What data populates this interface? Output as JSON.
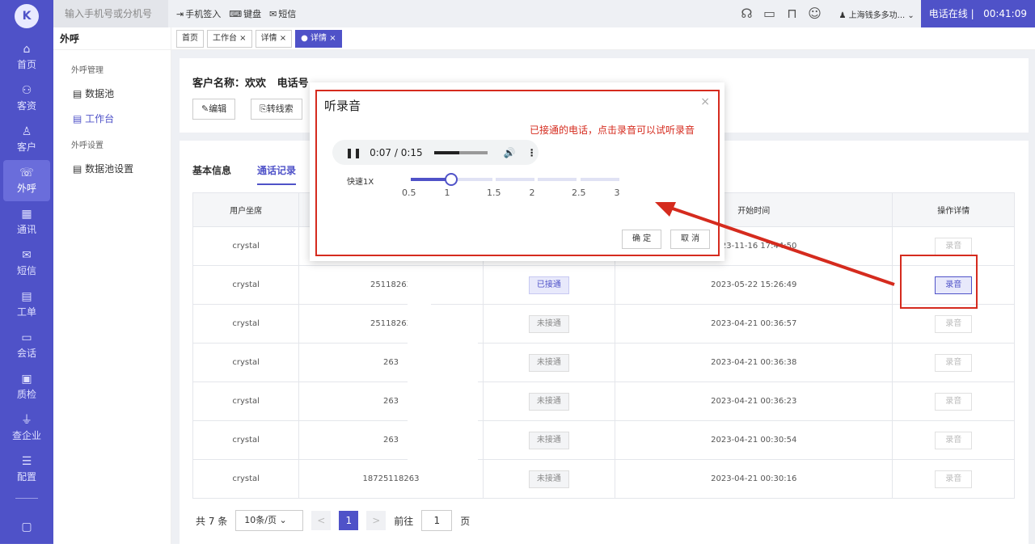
{
  "sidebar": {
    "logo": "K",
    "items": [
      {
        "icon": "⌂",
        "label": "首页"
      },
      {
        "icon": "⚇",
        "label": "客资"
      },
      {
        "icon": "♙",
        "label": "客户"
      },
      {
        "icon": "☏",
        "label": "外呼",
        "active": true
      },
      {
        "icon": "▦",
        "label": "通讯"
      },
      {
        "icon": "✉",
        "label": "短信"
      },
      {
        "icon": "▤",
        "label": "工单"
      },
      {
        "icon": "▭",
        "label": "会话"
      },
      {
        "icon": "▣",
        "label": "质检"
      },
      {
        "icon": "⏚",
        "label": "查企业"
      },
      {
        "icon": "☰",
        "label": "配置"
      },
      {
        "icon": "▢",
        "label": ""
      }
    ]
  },
  "topbar": {
    "search_placeholder": "输入手机号或分机号",
    "tool_signin": "手机签入",
    "tool_keyboard": "键盘",
    "tool_sms": "短信",
    "company": "上海钱多多功...",
    "status": "电话在线",
    "timer": "00:41:09"
  },
  "subnav": {
    "title": "外呼",
    "group1": "外呼管理",
    "link_datapool": "数据池",
    "link_workbench": "工作台",
    "group2": "外呼设置",
    "link_poolsetting": "数据池设置"
  },
  "tabs": [
    "首页",
    "工作台 ×",
    "详情 ×",
    "● 详情 ×"
  ],
  "customer": {
    "label": "客户名称：欢欢",
    "phone_label": "电话号"
  },
  "actions": {
    "edit": "编辑",
    "convert": "转线索"
  },
  "subtabs": {
    "basic": "基本信息",
    "records": "通话记录"
  },
  "table": {
    "headers": [
      "用户坐席",
      "",
      "",
      "开始时间",
      "操作详情"
    ],
    "rows": [
      {
        "agent": "crystal",
        "phone": "",
        "status": "",
        "start": "2023-11-16 17:44:50",
        "action": "录音",
        "active": false
      },
      {
        "agent": "crystal",
        "phone": "25118263",
        "status": "已接通",
        "start": "2023-05-22 15:26:49",
        "action": "录音",
        "active": true
      },
      {
        "agent": "crystal",
        "phone": "25118263",
        "status": "未接通",
        "start": "2023-04-21 00:36:57",
        "action": "录音",
        "active": false
      },
      {
        "agent": "crystal",
        "phone": "263",
        "status": "未接通",
        "start": "2023-04-21 00:36:38",
        "action": "录音",
        "active": false
      },
      {
        "agent": "crystal",
        "phone": "263",
        "status": "未接通",
        "start": "2023-04-21 00:36:23",
        "action": "录音",
        "active": false
      },
      {
        "agent": "crystal",
        "phone": "263",
        "status": "未接通",
        "start": "2023-04-21 00:30:54",
        "action": "录音",
        "active": false
      },
      {
        "agent": "crystal",
        "phone": "18725118263",
        "status": "未接通",
        "start": "2023-04-21 00:30:16",
        "action": "录音",
        "active": false
      }
    ]
  },
  "pager": {
    "total": "共 7 条",
    "size": "10条/页",
    "prev": "<",
    "page": "1",
    "next": ">",
    "goto": "前往",
    "goto_value": "1",
    "unit": "页"
  },
  "modal": {
    "title": "听录音",
    "close": "×",
    "hint": "已接通的电话，点击录音可以试听录音",
    "time": "0:07 / 0:15",
    "playback_fraction": 0.47,
    "speed_label": "快速1X",
    "speed_value": 1,
    "ticks": [
      "0.5",
      "1",
      "1.5",
      "2",
      "2.5",
      "3"
    ],
    "ok": "确 定",
    "cancel": "取 消"
  },
  "colors": {
    "brand": "#4f52c8",
    "annotation": "#d52b1e"
  }
}
